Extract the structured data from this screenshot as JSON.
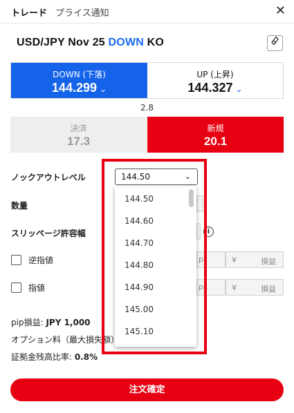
{
  "header": {
    "tab_trade": "トレード",
    "tab_price_alert": "プライス通知",
    "close_glyph": "✕"
  },
  "instrument": {
    "pair": "USD/JPY Nov 25 ",
    "direction": "DOWN",
    "suffix": " KO",
    "link_glyph": "🔗"
  },
  "prices": {
    "down_label": "DOWN (下落)",
    "down_value": "144.299",
    "up_label": "UP (上昇)",
    "up_value": "144.327",
    "chevron": "⌄",
    "spread": "2.8"
  },
  "modes": {
    "settle_label": "決済",
    "settle_value": "17.3",
    "new_label": "新規",
    "new_value": "20.1"
  },
  "form": {
    "knockout_label": "ノックアウトレベル",
    "knockout_selected": "144.50",
    "quantity_label": "数量",
    "slippage_label": "スリッページ許容幅",
    "stop_label": "逆指値",
    "limit_label": "指値",
    "pips_hint": "ps",
    "yen_symbol": "¥",
    "pnl_label": "損益",
    "info_glyph": "i"
  },
  "dropdown": {
    "options": [
      "144.50",
      "144.60",
      "144.70",
      "144.80",
      "144.90",
      "145.00",
      "145.10"
    ]
  },
  "info": {
    "pip_pnl_label": "pip損益: ",
    "pip_pnl_value": "JPY 1,000",
    "option_fee_label": "オプション料（最大損失額）",
    "margin_ratio_label": "証拠金残高比率: ",
    "margin_ratio_value": "0.8%"
  },
  "submit_label": "注文確定",
  "colors": {
    "accent_blue": "#1463e8",
    "accent_red": "#e60012"
  }
}
